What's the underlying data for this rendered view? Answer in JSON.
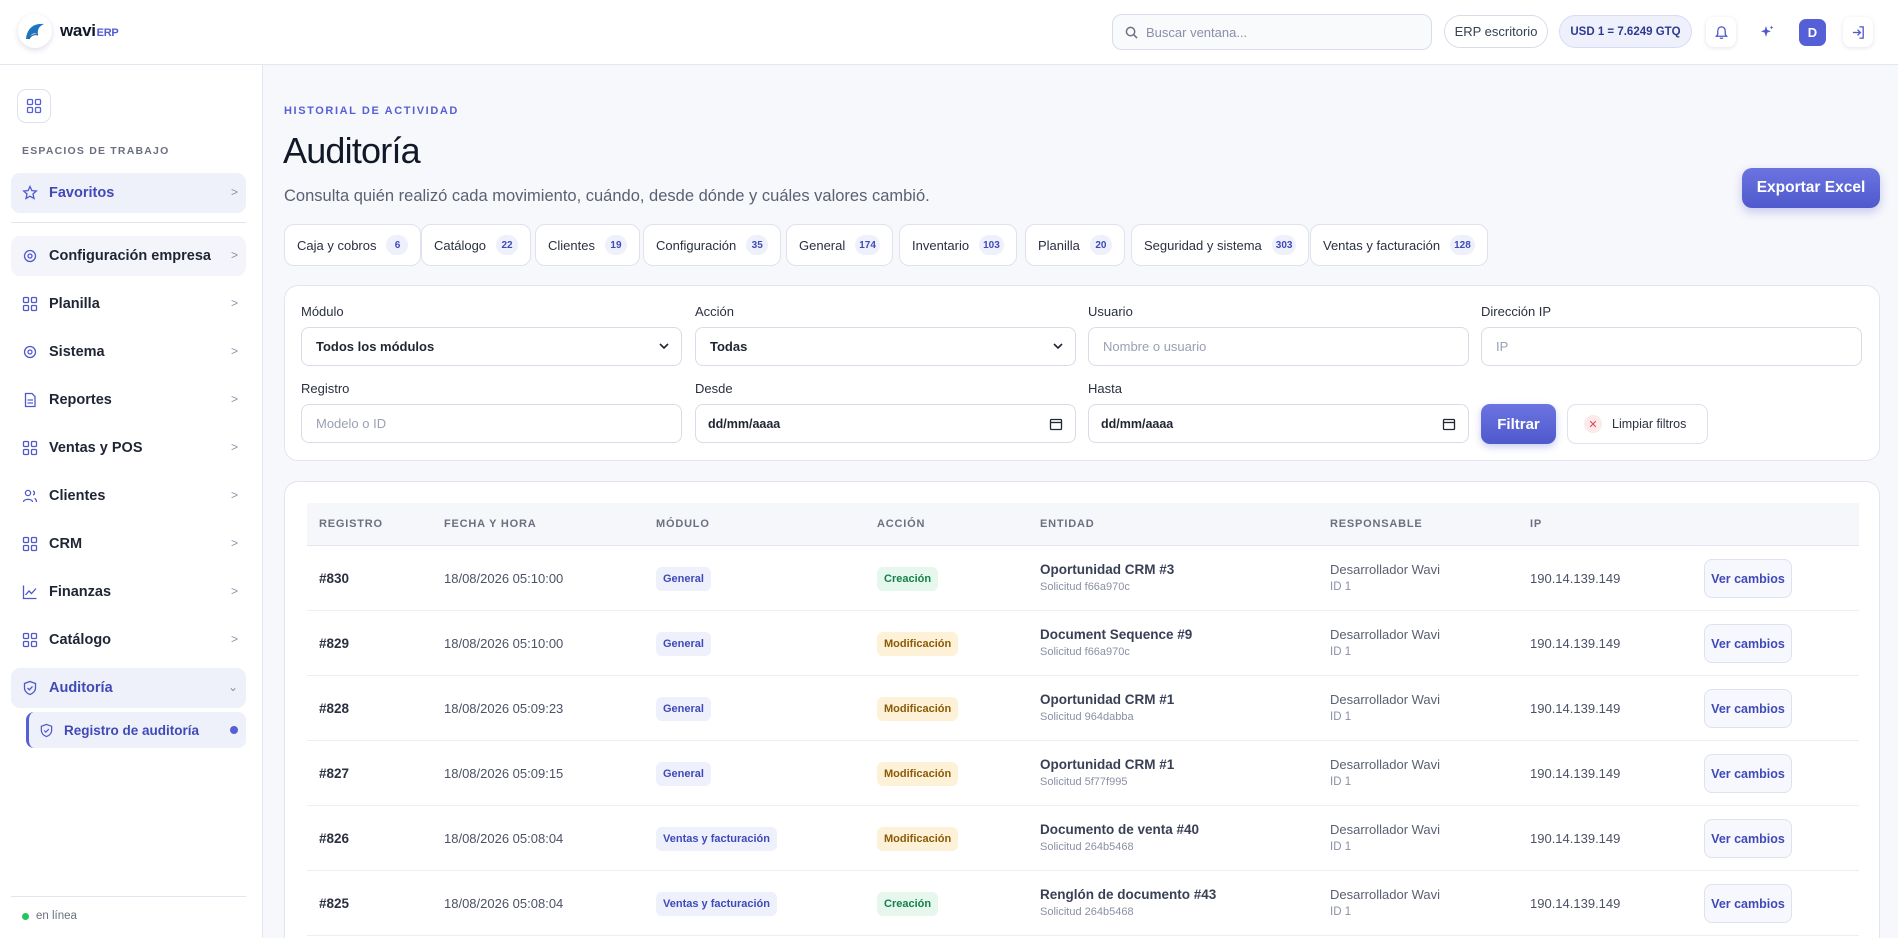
{
  "brand": {
    "name": "wavi",
    "suffix": "ERP"
  },
  "topbar": {
    "search_placeholder": "Buscar ventana...",
    "erp_label": "ERP escritorio",
    "rate_label": "USD 1 = 7.6249 GTQ",
    "avatar_initial": "D"
  },
  "sidebar": {
    "workspaces_label": "ESPACIOS DE TRABAJO",
    "favorites": "Favoritos",
    "items": [
      {
        "label": "Configuración empresa",
        "icon": "settings-icon"
      },
      {
        "label": "Planilla",
        "icon": "grid-icon"
      },
      {
        "label": "Sistema",
        "icon": "settings-icon"
      },
      {
        "label": "Reportes",
        "icon": "document-icon"
      },
      {
        "label": "Ventas y POS",
        "icon": "grid-icon"
      },
      {
        "label": "Clientes",
        "icon": "users-icon"
      },
      {
        "label": "CRM",
        "icon": "grid-icon"
      },
      {
        "label": "Finanzas",
        "icon": "chart-icon"
      },
      {
        "label": "Catálogo",
        "icon": "grid-icon"
      },
      {
        "label": "Auditoría",
        "icon": "shield-icon"
      }
    ],
    "sub_item": "Registro de auditoría",
    "status": "en línea"
  },
  "page": {
    "eyebrow": "HISTORIAL DE ACTIVIDAD",
    "title": "Auditoría",
    "subtitle": "Consulta quién realizó cada movimiento, cuándo, desde dónde y cuáles valores cambió.",
    "export_label": "Exportar Excel"
  },
  "chips": [
    {
      "label": "Caja y cobros",
      "count": "6"
    },
    {
      "label": "Catálogo",
      "count": "22"
    },
    {
      "label": "Clientes",
      "count": "19"
    },
    {
      "label": "Configuración",
      "count": "35"
    },
    {
      "label": "General",
      "count": "174"
    },
    {
      "label": "Inventario",
      "count": "103"
    },
    {
      "label": "Planilla",
      "count": "20"
    },
    {
      "label": "Seguridad y sistema",
      "count": "303"
    },
    {
      "label": "Ventas y facturación",
      "count": "128"
    }
  ],
  "filters": {
    "module_label": "Módulo",
    "module_value": "Todos los módulos",
    "action_label": "Acción",
    "action_value": "Todas",
    "user_label": "Usuario",
    "user_placeholder": "Nombre o usuario",
    "ip_label": "Dirección IP",
    "ip_placeholder": "IP",
    "record_label": "Registro",
    "record_placeholder": "Modelo o ID",
    "from_label": "Desde",
    "from_value": "dd/mm/aaaa",
    "to_label": "Hasta",
    "to_value": "dd/mm/aaaa",
    "filter_button": "Filtrar",
    "clear_button": "Limpiar filtros"
  },
  "table": {
    "headers": [
      "REGISTRO",
      "FECHA Y HORA",
      "MÓDULO",
      "ACCIÓN",
      "ENTIDAD",
      "RESPONSABLE",
      "IP"
    ],
    "view_label": "Ver cambios",
    "rows": [
      {
        "id": "#830",
        "datetime": "18/08/2026 05:10:00",
        "module": "General",
        "action": "Creación",
        "action_kind": "create",
        "entity": "Oportunidad CRM #3",
        "request": "Solicitud f66a970c",
        "user": "Desarrollador Wavi",
        "user_id": "ID 1",
        "ip": "190.14.139.149"
      },
      {
        "id": "#829",
        "datetime": "18/08/2026 05:10:00",
        "module": "General",
        "action": "Modificación",
        "action_kind": "modif",
        "entity": "Document Sequence #9",
        "request": "Solicitud f66a970c",
        "user": "Desarrollador Wavi",
        "user_id": "ID 1",
        "ip": "190.14.139.149"
      },
      {
        "id": "#828",
        "datetime": "18/08/2026 05:09:23",
        "module": "General",
        "action": "Modificación",
        "action_kind": "modif",
        "entity": "Oportunidad CRM #1",
        "request": "Solicitud 964dabba",
        "user": "Desarrollador Wavi",
        "user_id": "ID 1",
        "ip": "190.14.139.149"
      },
      {
        "id": "#827",
        "datetime": "18/08/2026 05:09:15",
        "module": "General",
        "action": "Modificación",
        "action_kind": "modif",
        "entity": "Oportunidad CRM #1",
        "request": "Solicitud 5f77f995",
        "user": "Desarrollador Wavi",
        "user_id": "ID 1",
        "ip": "190.14.139.149"
      },
      {
        "id": "#826",
        "datetime": "18/08/2026 05:08:04",
        "module": "Ventas y facturación",
        "action": "Modificación",
        "action_kind": "modif",
        "entity": "Documento de venta #40",
        "request": "Solicitud 264b5468",
        "user": "Desarrollador Wavi",
        "user_id": "ID 1",
        "ip": "190.14.139.149"
      },
      {
        "id": "#825",
        "datetime": "18/08/2026 05:08:04",
        "module": "Ventas y facturación",
        "action": "Creación",
        "action_kind": "create",
        "entity": "Renglón de documento #43",
        "request": "Solicitud 264b5468",
        "user": "Desarrollador Wavi",
        "user_id": "ID 1",
        "ip": "190.14.139.149"
      }
    ]
  }
}
